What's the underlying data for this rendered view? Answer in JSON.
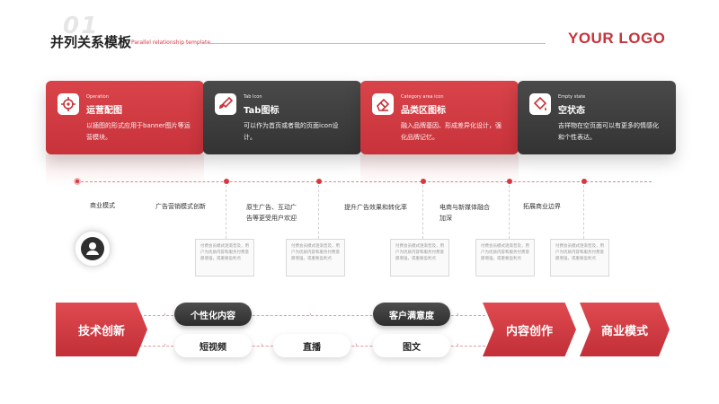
{
  "header": {
    "number": "01",
    "title": "并列关系模板",
    "subtitle": "Parallel relationship template",
    "logo": "YOUR LOGO"
  },
  "cards": [
    {
      "tag": "Operation",
      "title": "运营配图",
      "desc": "以插图的形式应用于banner图片等运营模块。",
      "icon": "target-icon",
      "style": "red"
    },
    {
      "tag": "Tab Icon",
      "title": "Tab图标",
      "desc": "可以作为首页或者我的页面icon设计。",
      "icon": "brush-icon",
      "style": "dark"
    },
    {
      "tag": "Category area icon",
      "title": "品类区图标",
      "desc": "融入品牌基因、形成差异化设计，强化品牌记忆。",
      "icon": "eraser-icon",
      "style": "red"
    },
    {
      "tag": "Empty state",
      "title": "空状态",
      "desc": "吉祥物在空页面可以有更多的情感化和个性表达。",
      "icon": "paint-bucket-icon",
      "style": "dark"
    }
  ],
  "timeline": {
    "start_label": "商业模式",
    "nodes": [
      {
        "label": "广告营销模式创新"
      },
      {
        "label": "原生广告、互动广告等更受用户欢迎"
      },
      {
        "label": "提升广告效果和转化率"
      },
      {
        "label": "电商与新媒体融合加深"
      },
      {
        "label": "拓展商业边界"
      }
    ],
    "box_text": "付费会员模式逐渐普及，用户为优质内容和服务付费意愿增强，或重要盈利点"
  },
  "flow": {
    "chevrons": [
      "技术创新",
      "内容创作",
      "商业模式"
    ],
    "dark_pills": [
      "个性化内容",
      "客户满意度"
    ],
    "light_pills": [
      "短视频",
      "直播",
      "图文"
    ]
  },
  "colors": {
    "accent": "#d9363e",
    "dark": "#333333",
    "logo": "#c8323a"
  }
}
